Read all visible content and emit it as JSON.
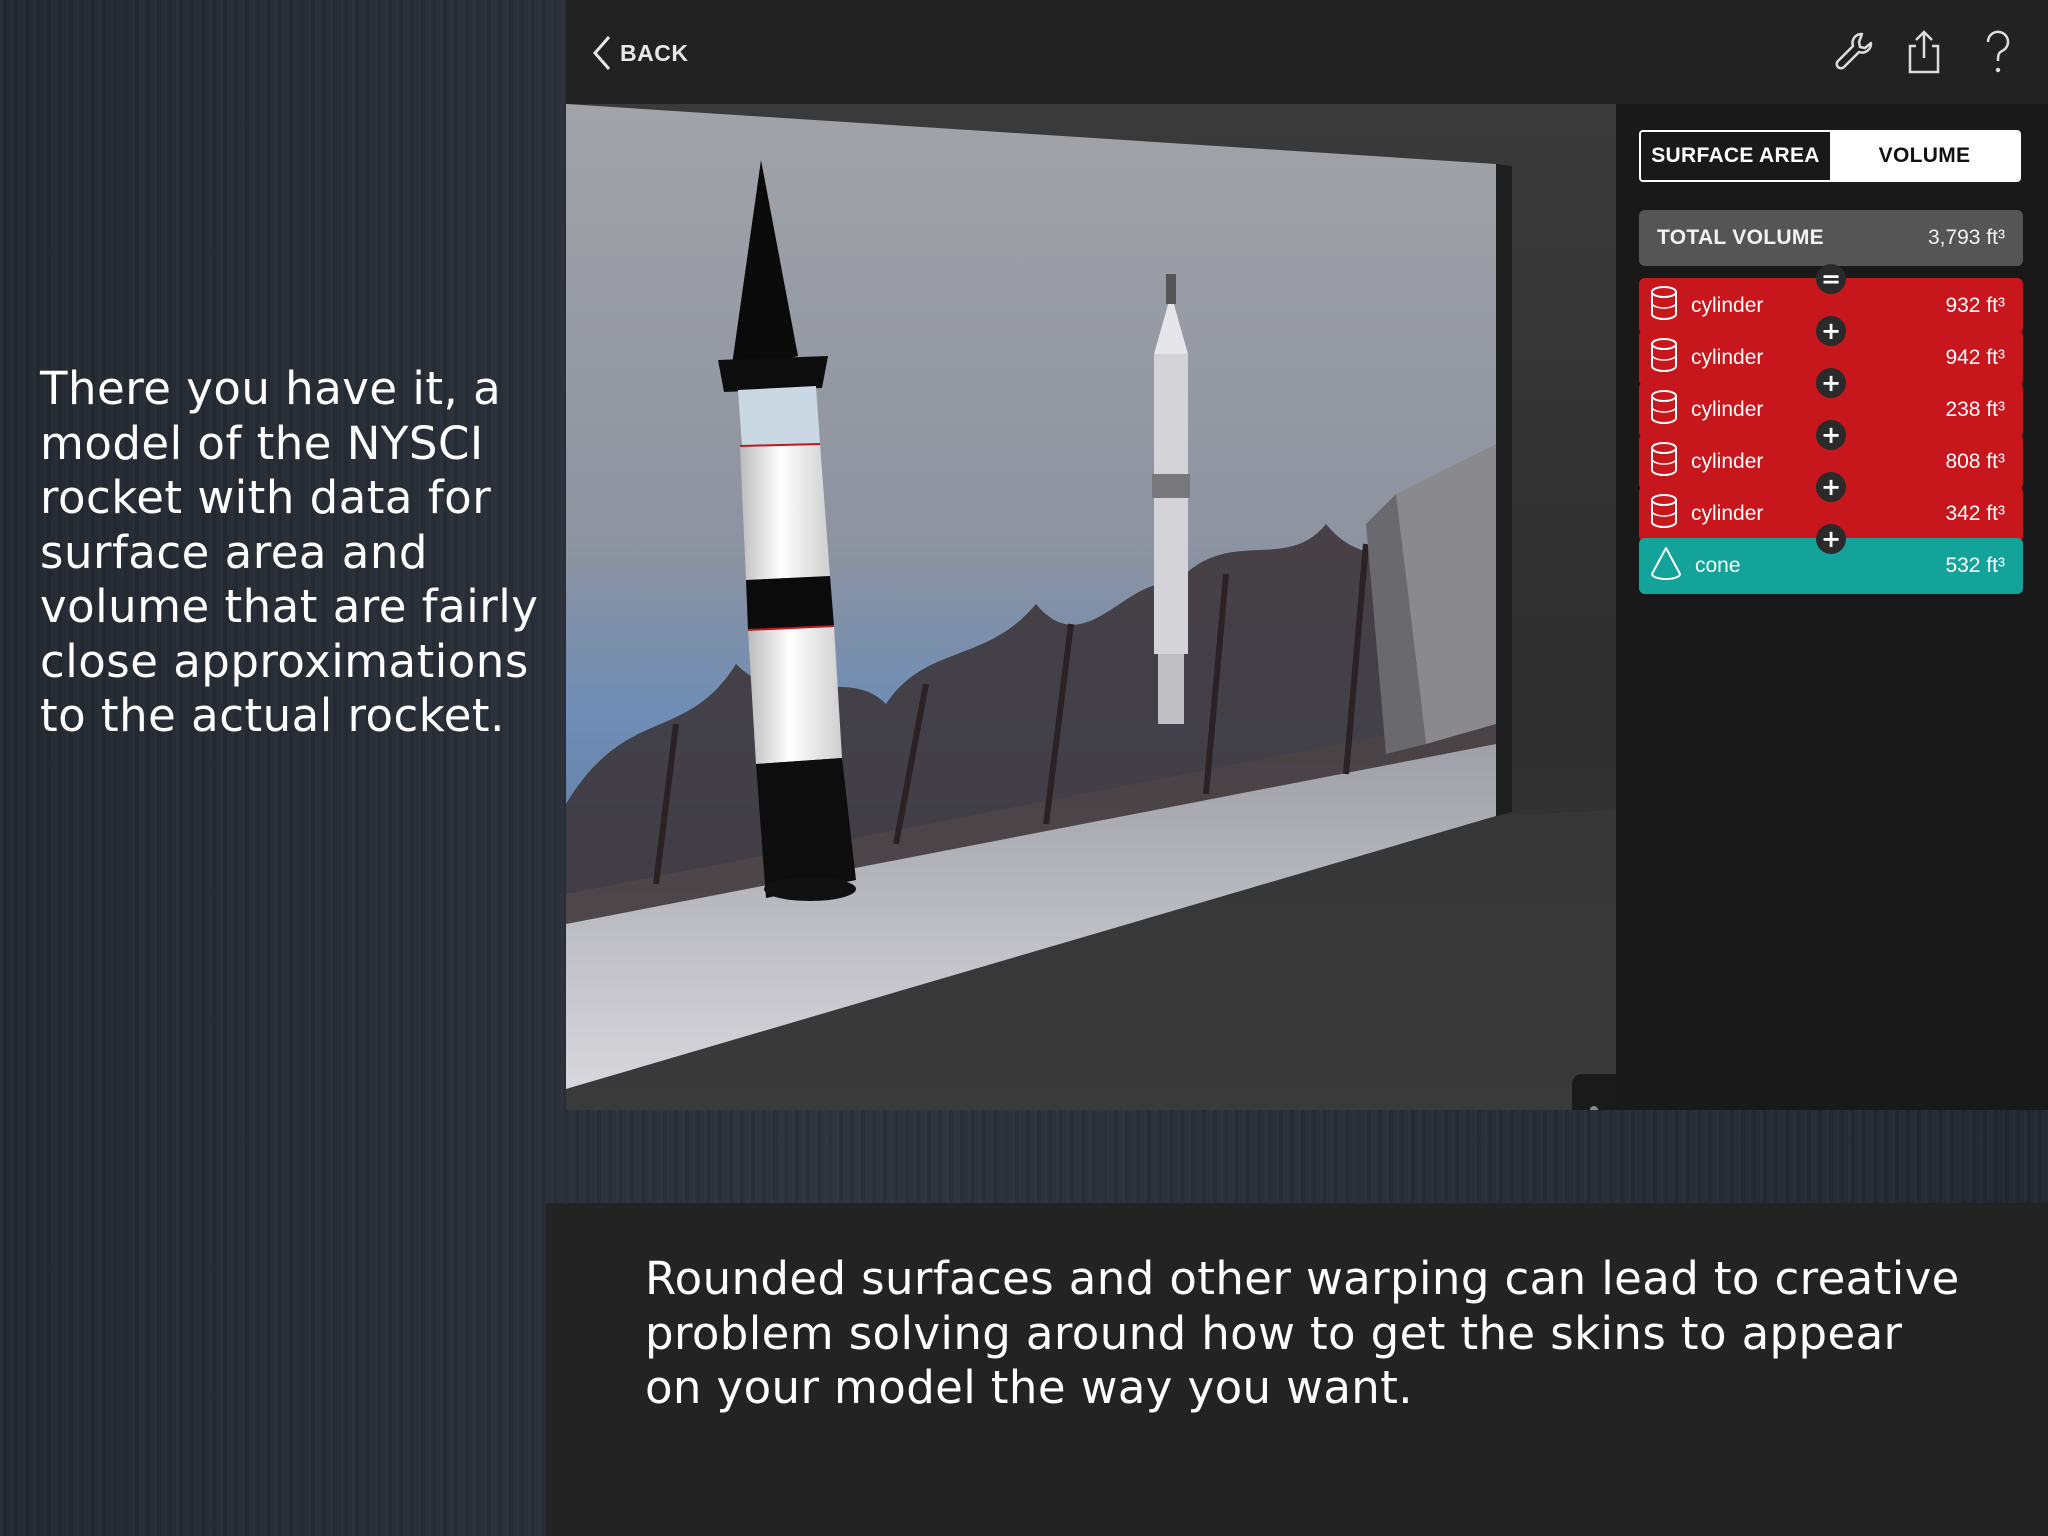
{
  "captions": {
    "left": "There you have it, a\nmodel of the NYSCI\nrocket with data for\nsurface area and\nvolume that are fairly\nclose approximations\nto the actual rocket.",
    "bottom": "Rounded surfaces and other warping can lead to creative\nproblem solving around how to get the skins to appear\non your model the way you want."
  },
  "app": {
    "back_label": "BACK",
    "toolbar_icons": [
      "wrench-icon",
      "share-icon",
      "help-icon"
    ],
    "tabs": [
      {
        "label": "SURFACE AREA",
        "selected": false
      },
      {
        "label": "VOLUME",
        "selected": true
      }
    ],
    "total": {
      "label": "TOTAL VOLUME",
      "value": "3,793 ft³"
    },
    "shapes": [
      {
        "name": "cylinder",
        "value": "932 ft³",
        "color": "#c8161d",
        "icon": "cylinder-icon"
      },
      {
        "name": "cylinder",
        "value": "942 ft³",
        "color": "#c8161d",
        "icon": "cylinder-icon"
      },
      {
        "name": "cylinder",
        "value": "238 ft³",
        "color": "#c8161d",
        "icon": "cylinder-icon"
      },
      {
        "name": "cylinder",
        "value": "808 ft³",
        "color": "#c8161d",
        "icon": "cylinder-icon"
      },
      {
        "name": "cylinder",
        "value": "342 ft³",
        "color": "#c8161d",
        "icon": "cylinder-icon"
      },
      {
        "name": "cone",
        "value": "532 ft³",
        "color": "#14a39a",
        "icon": "cone-icon"
      }
    ],
    "connectors": [
      "=",
      "+",
      "+",
      "+",
      "+",
      "+"
    ]
  }
}
